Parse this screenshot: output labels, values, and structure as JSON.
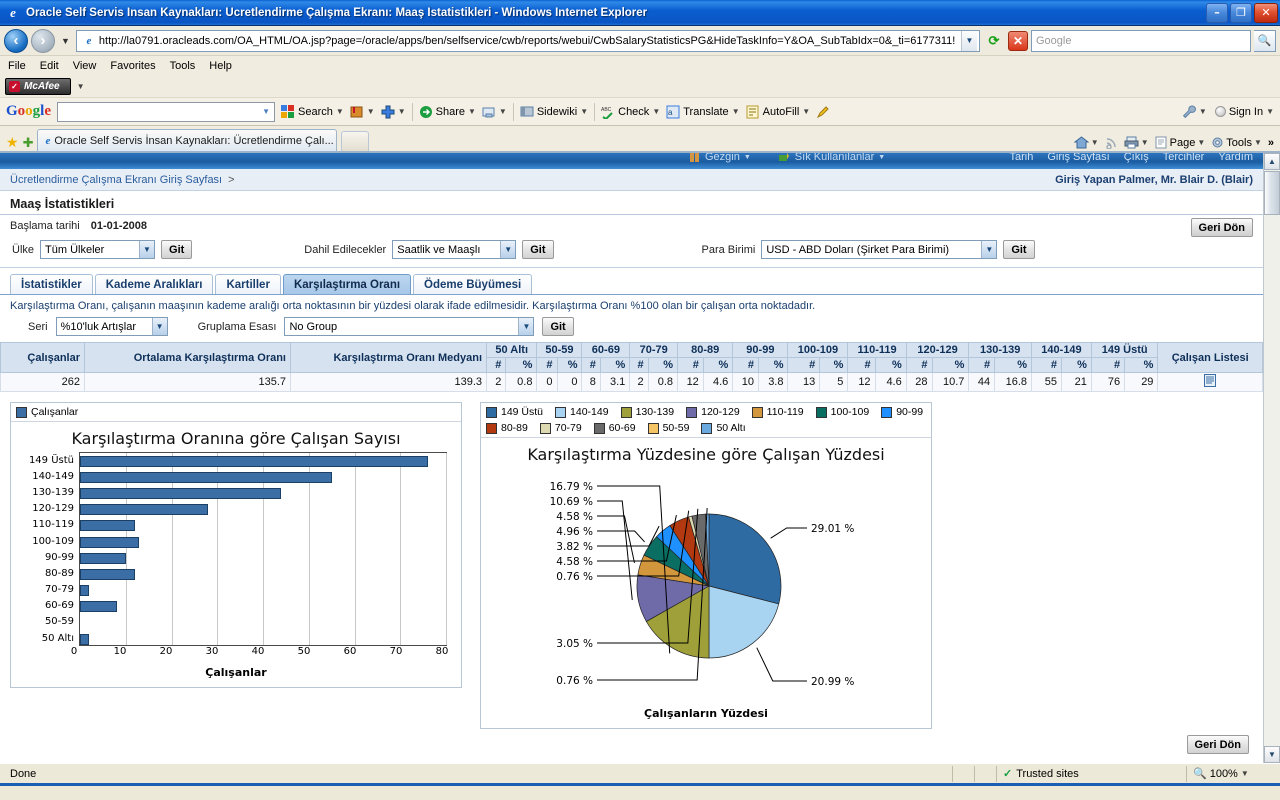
{
  "window": {
    "title": "Oracle Self Servis İnsan Kaynakları: Ücretlendirme Çalışma Ekranı: Maaş İstatistikleri - Windows Internet Explorer",
    "minimize": "–",
    "maximize": "❐",
    "close": "✕"
  },
  "browser": {
    "url": "http://la0791.oracleads.com/OA_HTML/OA.jsp?page=/oracle/apps/ben/selfservice/cwb/reports/webui/CwbSalaryStatisticsPG&HideTaskInfo=Y&OA_SubTabIdx=0&_ti=6177311!",
    "search_placeholder": "Google",
    "menu": [
      "File",
      "Edit",
      "View",
      "Favorites",
      "Tools",
      "Help"
    ],
    "mcafee_label": "McAfee",
    "tab_title": "Oracle Self Servis İnsan Kaynakları: Ücretlendirme Çalı...",
    "command_bar": [
      {
        "label": "Page",
        "icon": "page-icon"
      },
      {
        "label": "Tools",
        "icon": "gear-icon"
      }
    ],
    "command_overflow": "»"
  },
  "google_toolbar": {
    "logo": "Google",
    "query": "",
    "items": [
      {
        "label": "Search",
        "icon": "google-search-icon"
      },
      {
        "label": "",
        "icon": "bookmarks-icon"
      },
      {
        "label": "",
        "icon": "plus-icon"
      },
      {
        "label": "Share",
        "icon": "share-icon"
      },
      {
        "label": "",
        "icon": "send-to-icon"
      },
      {
        "label": "Sidewiki",
        "icon": "sidewiki-icon"
      },
      {
        "label": "Check",
        "icon": "spellcheck-icon"
      },
      {
        "label": "Translate",
        "icon": "translate-icon"
      },
      {
        "label": "AutoFill",
        "icon": "autofill-icon"
      },
      {
        "label": "",
        "icon": "highlighter-icon"
      }
    ],
    "settings_label": "",
    "signin_label": "Sign In"
  },
  "oracle_nav": {
    "left": [
      {
        "label": "Gezgin",
        "icon": "navigator-icon"
      },
      {
        "label": "Sık Kullanılanlar",
        "icon": "favorites-icon"
      }
    ],
    "right": [
      "Tarih",
      "Giriş Sayfası",
      "Çıkış",
      "Tercihler",
      "Yardım"
    ]
  },
  "breadcrumb": {
    "path": "Ücretlendirme Çalışma Ekranı Giriş Sayfası",
    "separator": ">",
    "user": "Giriş Yapan Palmer, Mr. Blair D. (Blair)"
  },
  "page": {
    "title": "Maaş İstatistikleri",
    "start_date_label": "Başlama tarihi",
    "start_date_value": "01-01-2008",
    "back_button": "Geri Dön",
    "bottom_back_button": "Geri Dön"
  },
  "filters": [
    {
      "label": "Ülke",
      "value": "Tüm Ülkeler",
      "go": "Git"
    },
    {
      "label": "Dahil Edilecekler",
      "value": "Saatlik ve Maaşlı",
      "go": "Git"
    },
    {
      "label": "Para Birimi",
      "value": "USD - ABD Doları (Şirket Para Birimi)",
      "go": "Git"
    }
  ],
  "tabs": [
    {
      "label": "İstatistikler",
      "active": false
    },
    {
      "label": "Kademe Aralıkları",
      "active": false
    },
    {
      "label": "Kartiller",
      "active": false
    },
    {
      "label": "Karşılaştırma Oranı",
      "active": true
    },
    {
      "label": "Ödeme Büyümesi",
      "active": false
    }
  ],
  "tab_description": "Karşılaştırma Oranı, çalışanın maaşının kademe aralığı orta noktasının bir yüzdesi olarak ifade edilmesidir. Karşılaştırma Oranı %100 olan bir çalışan orta noktadadır.",
  "series_controls": {
    "seri_label": "Seri",
    "seri_value": "%10'luk Artışlar",
    "grouping_label": "Gruplama Esası",
    "grouping_value": "No Group",
    "go": "Git"
  },
  "table": {
    "base_headers": [
      "Çalışanlar",
      "Ortalama Karşılaştırma Oranı",
      "Karşılaştırma Oranı Medyanı"
    ],
    "base_values": [
      "262",
      "135.7",
      "139.3"
    ],
    "band_sub_headers": [
      "#",
      "%"
    ],
    "bands": [
      {
        "label": "50 Altı",
        "count": "2",
        "pct": "0.8"
      },
      {
        "label": "50-59",
        "count": "0",
        "pct": "0"
      },
      {
        "label": "60-69",
        "count": "8",
        "pct": "3.1"
      },
      {
        "label": "70-79",
        "count": "2",
        "pct": "0.8"
      },
      {
        "label": "80-89",
        "count": "12",
        "pct": "4.6"
      },
      {
        "label": "90-99",
        "count": "10",
        "pct": "3.8"
      },
      {
        "label": "100-109",
        "count": "13",
        "pct": "5"
      },
      {
        "label": "110-119",
        "count": "12",
        "pct": "4.6"
      },
      {
        "label": "120-129",
        "count": "28",
        "pct": "10.7"
      },
      {
        "label": "130-139",
        "count": "44",
        "pct": "16.8"
      },
      {
        "label": "140-149",
        "count": "55",
        "pct": "21"
      },
      {
        "label": "149 Üstü",
        "count": "76",
        "pct": "29"
      }
    ],
    "employee_list_header": "Çalışan Listesi",
    "employee_list_icon": "list-report-icon"
  },
  "chart_data": [
    {
      "type": "bar",
      "orientation": "horizontal",
      "title": "Karşılaştırma Oranına göre Çalışan Sayısı",
      "legend": [
        "Çalışanlar"
      ],
      "legend_position": "top-left",
      "xlabel": "Çalışanlar",
      "ylabel": "",
      "xlim": [
        0,
        80
      ],
      "xticks": [
        0,
        10,
        20,
        30,
        40,
        50,
        60,
        70,
        80
      ],
      "grid": true,
      "series_color": "#3a6ea5",
      "categories": [
        "149 Üstü",
        "140-149",
        "130-139",
        "120-129",
        "110-119",
        "100-109",
        "90-99",
        "80-89",
        "70-79",
        "60-69",
        "50-59",
        "50 Altı"
      ],
      "values": [
        76,
        55,
        44,
        28,
        12,
        13,
        10,
        12,
        2,
        8,
        0,
        2
      ]
    },
    {
      "type": "pie",
      "title": "Karşılaştırma Yüzdesine göre Çalışan Yüzdesi",
      "xlabel": "Çalışanların Yüzdesi",
      "legend_position": "top",
      "labels": [
        "149 Üstü",
        "140-149",
        "130-139",
        "120-129",
        "110-119",
        "100-109",
        "90-99",
        "80-89",
        "70-79",
        "60-69",
        "50-59",
        "50 Altı"
      ],
      "values": [
        29.01,
        20.99,
        16.79,
        10.69,
        4.58,
        4.96,
        3.82,
        4.58,
        0.76,
        3.05,
        0,
        0.76
      ],
      "value_labels": [
        "29.01 %",
        "20.99 %",
        "16.79 %",
        "10.69 %",
        "4.58 %",
        "4.96 %",
        "3.82 %",
        "4.58 %",
        "0.76 %",
        "3.05 %",
        "",
        "0.76 %"
      ],
      "colors": [
        "#2e6ba3",
        "#a8d4f2",
        "#a0a03a",
        "#6f6aa8",
        "#d2973c",
        "#0a6e62",
        "#1e90ff",
        "#b33a10",
        "#ddd9b0",
        "#6a6a6a",
        "#f5c465",
        "#6aa8e0"
      ]
    }
  ],
  "statusbar": {
    "status": "Done",
    "zone": "Trusted sites",
    "zone_icon": "shield-check-icon",
    "zoom": "100%",
    "zoom_icon": "magnifier-icon"
  }
}
